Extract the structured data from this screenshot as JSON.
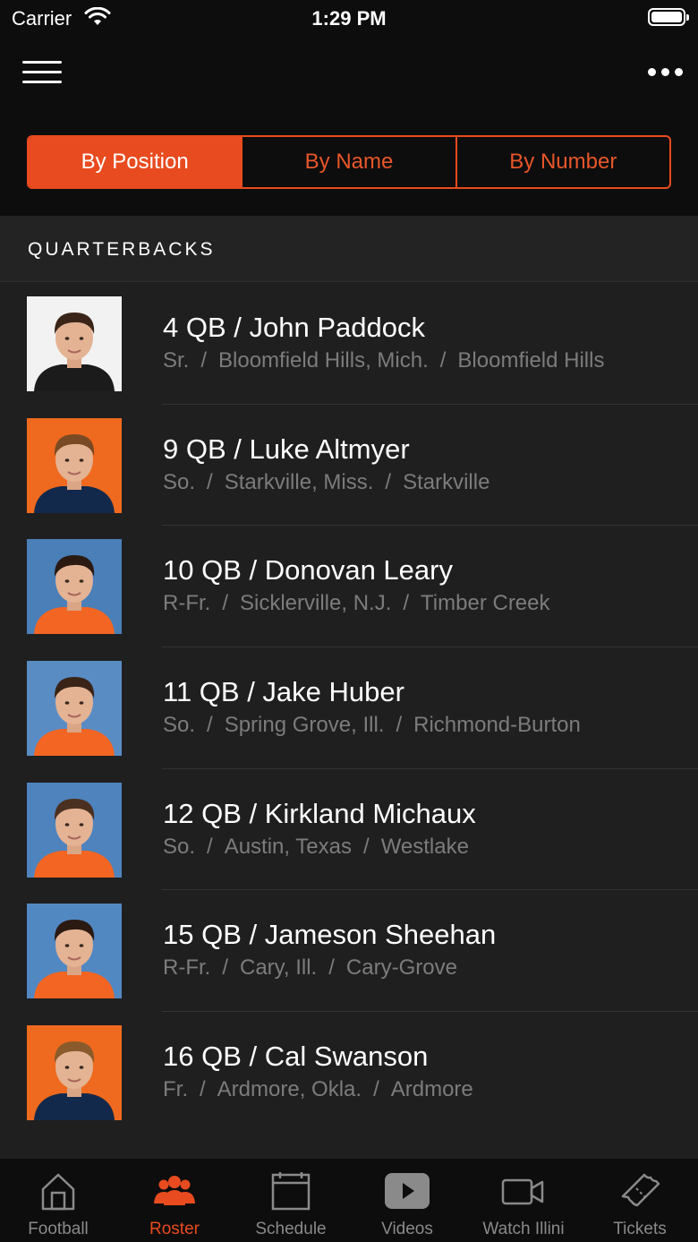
{
  "status_bar": {
    "carrier": "Carrier",
    "time": "1:29 PM"
  },
  "nav": {
    "menu_icon": "hamburger-menu-icon",
    "more_icon": "more-dots-icon"
  },
  "segments": [
    {
      "label": "By Position",
      "active": true
    },
    {
      "label": "By Name",
      "active": false
    },
    {
      "label": "By Number",
      "active": false
    }
  ],
  "section": {
    "title": "QUARTERBACKS"
  },
  "players": [
    {
      "name": "4 QB / John Paddock",
      "year": "Sr.",
      "hometown": "Bloomfield Hills, Mich.",
      "school": "Bloomfield Hills",
      "photo_bg": "#f2f2f2",
      "shirt": "#1b1b1b",
      "hair": "#3a2518"
    },
    {
      "name": "9 QB / Luke Altmyer",
      "year": "So.",
      "hometown": "Starkville, Miss.",
      "school": "Starkville",
      "photo_bg": "#ef6a1e",
      "shirt": "#13294b",
      "hair": "#7a4a24"
    },
    {
      "name": "10 QB / Donovan Leary",
      "year": "R-Fr.",
      "hometown": "Sicklerville, N.J.",
      "school": "Timber Creek",
      "photo_bg": "#4a7fb8",
      "shirt": "#f26522",
      "hair": "#2a1a12"
    },
    {
      "name": "11 QB / Jake Huber",
      "year": "So.",
      "hometown": "Spring Grove, Ill.",
      "school": "Richmond-Burton",
      "photo_bg": "#5a8cc4",
      "shirt": "#f26522",
      "hair": "#3a2418"
    },
    {
      "name": "12 QB / Kirkland Michaux",
      "year": "So.",
      "hometown": "Austin, Texas",
      "school": "Westlake",
      "photo_bg": "#4f83bd",
      "shirt": "#f26522",
      "hair": "#4a3020"
    },
    {
      "name": "15 QB / Jameson Sheehan",
      "year": "R-Fr.",
      "hometown": "Cary, Ill.",
      "school": "Cary-Grove",
      "photo_bg": "#5288c2",
      "shirt": "#f26522",
      "hair": "#2a1a12"
    },
    {
      "name": "16 QB / Cal Swanson",
      "year": "Fr.",
      "hometown": "Ardmore, Okla.",
      "school": "Ardmore",
      "photo_bg": "#ef6a1e",
      "shirt": "#13294b",
      "hair": "#8a5a2c"
    }
  ],
  "tabs": [
    {
      "label": "Football",
      "icon": "home-icon",
      "active": false
    },
    {
      "label": "Roster",
      "icon": "roster-people-icon",
      "active": true
    },
    {
      "label": "Schedule",
      "icon": "calendar-icon",
      "active": false
    },
    {
      "label": "Videos",
      "icon": "play-video-icon",
      "active": false
    },
    {
      "label": "Watch Illini",
      "icon": "video-camera-icon",
      "active": false
    },
    {
      "label": "Tickets",
      "icon": "ticket-icon",
      "active": false
    }
  ],
  "colors": {
    "accent": "#e84b1f",
    "background": "#1f1f1f",
    "muted_text": "#7c7c7c"
  }
}
